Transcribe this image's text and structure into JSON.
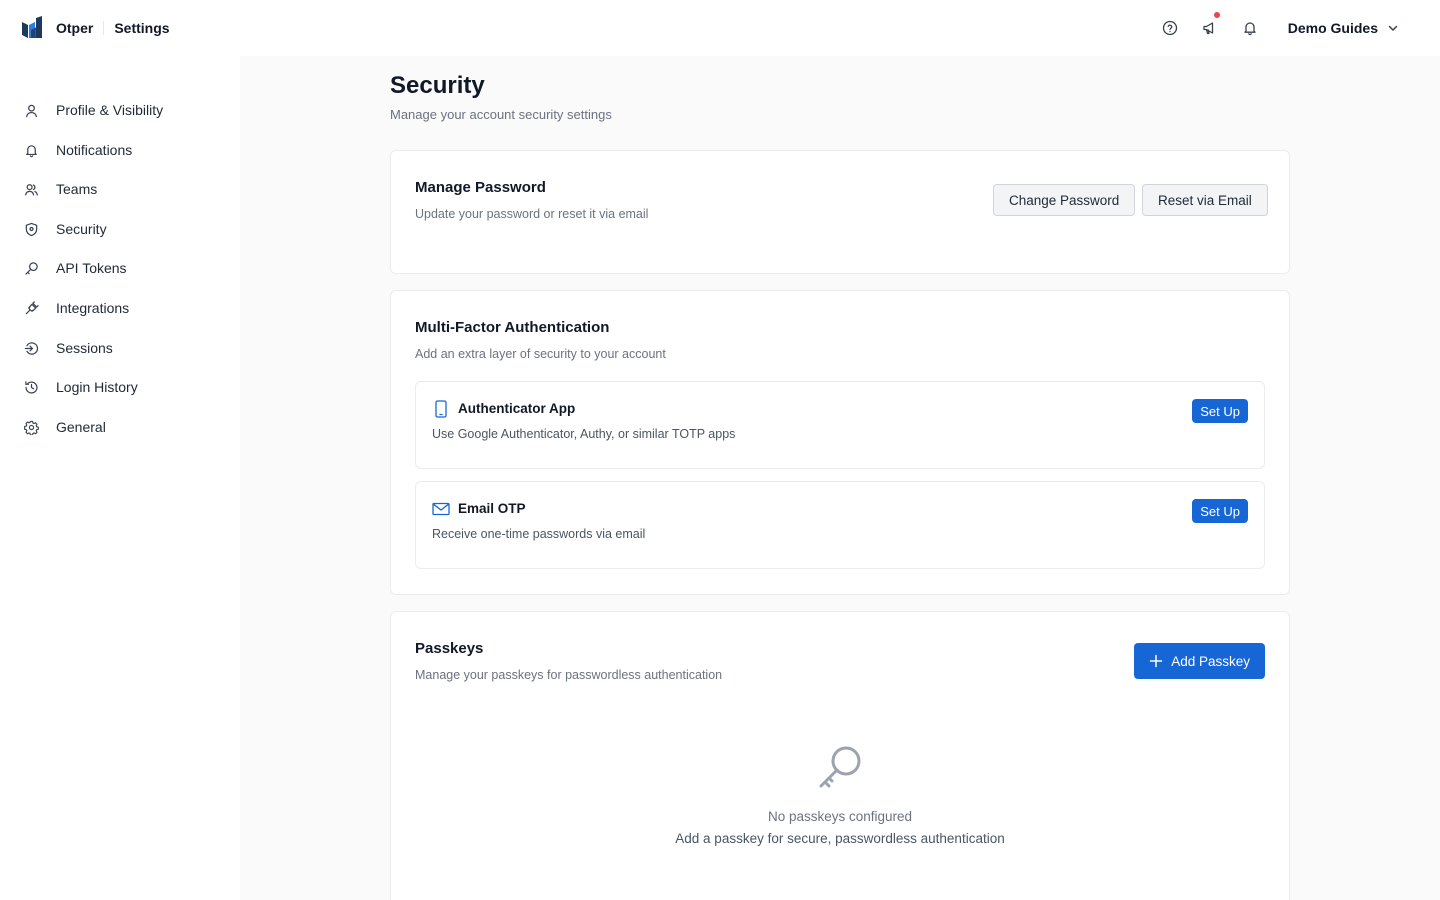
{
  "header": {
    "app_name": "Otper",
    "section": "Settings",
    "user_name": "Demo Guides",
    "icons": [
      "help-icon",
      "announcement-icon",
      "bell-icon",
      "chevron-down-icon"
    ],
    "notification_dot_color": "#ef4444"
  },
  "sidebar": {
    "items": [
      {
        "label": "Profile & Visibility",
        "icon": "user-icon"
      },
      {
        "label": "Notifications",
        "icon": "bell-icon"
      },
      {
        "label": "Teams",
        "icon": "users-icon"
      },
      {
        "label": "Security",
        "icon": "shield-icon"
      },
      {
        "label": "API Tokens",
        "icon": "key-icon"
      },
      {
        "label": "Integrations",
        "icon": "plug-icon"
      },
      {
        "label": "Sessions",
        "icon": "login-icon"
      },
      {
        "label": "Login History",
        "icon": "history-icon"
      },
      {
        "label": "General",
        "icon": "gear-icon"
      }
    ],
    "active": "Security"
  },
  "page": {
    "title": "Security",
    "subtitle": "Manage your account security settings"
  },
  "password": {
    "title": "Manage Password",
    "description": "Update your password or reset it via email",
    "change_label": "Change Password",
    "reset_label": "Reset via Email"
  },
  "mfa": {
    "title": "Multi-Factor Authentication",
    "description": "Add an extra layer of security to your account",
    "methods": [
      {
        "title": "Authenticator App",
        "description": "Use Google Authenticator, Authy, or similar TOTP apps",
        "action": "Set Up",
        "icon": "smartphone-icon"
      },
      {
        "title": "Email OTP",
        "description": "Receive one-time passwords via email",
        "action": "Set Up",
        "icon": "mail-icon"
      }
    ]
  },
  "passkeys": {
    "title": "Passkeys",
    "description": "Manage your passkeys for passwordless authentication",
    "add_label": "Add Passkey",
    "empty_title": "No passkeys configured",
    "empty_description": "Add a passkey for secure, passwordless authentication",
    "empty_icon": "key-icon"
  },
  "colors": {
    "primary": "#1766d6",
    "accent_icon": "#1766d6",
    "main_background": "#fafafa"
  }
}
